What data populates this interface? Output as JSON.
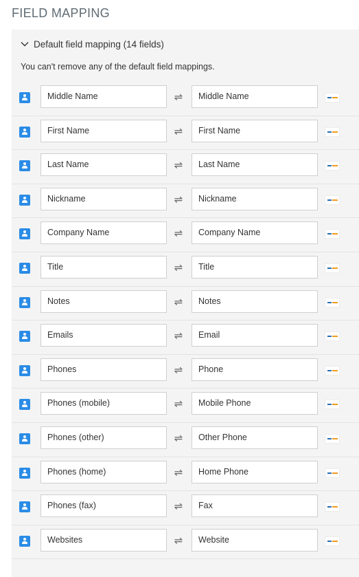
{
  "section_title": "FIELD MAPPING",
  "accordion": {
    "title": "Default field mapping (14 fields)",
    "note": "You can't remove any of the default field mappings."
  },
  "icons": {
    "source": "contact-card-icon",
    "swap": "swap-arrows-icon",
    "destination": "app-logo-icon",
    "toggle": "chevron-down-icon"
  },
  "colors": {
    "accent": "#2b8ce6",
    "panel_bg": "#f4f4f4",
    "heading": "#5f6b73"
  },
  "mappings": [
    {
      "source": "Middle Name",
      "target": "Middle Name"
    },
    {
      "source": "First Name",
      "target": "First Name"
    },
    {
      "source": "Last Name",
      "target": "Last Name"
    },
    {
      "source": "Nickname",
      "target": "Nickname"
    },
    {
      "source": "Company Name",
      "target": "Company Name"
    },
    {
      "source": "Title",
      "target": "Title"
    },
    {
      "source": "Notes",
      "target": "Notes"
    },
    {
      "source": "Emails",
      "target": "Email"
    },
    {
      "source": "Phones",
      "target": "Phone"
    },
    {
      "source": "Phones (mobile)",
      "target": "Mobile Phone"
    },
    {
      "source": "Phones (other)",
      "target": "Other Phone"
    },
    {
      "source": "Phones (home)",
      "target": "Home Phone"
    },
    {
      "source": "Phones (fax)",
      "target": "Fax"
    },
    {
      "source": "Websites",
      "target": "Website"
    }
  ]
}
